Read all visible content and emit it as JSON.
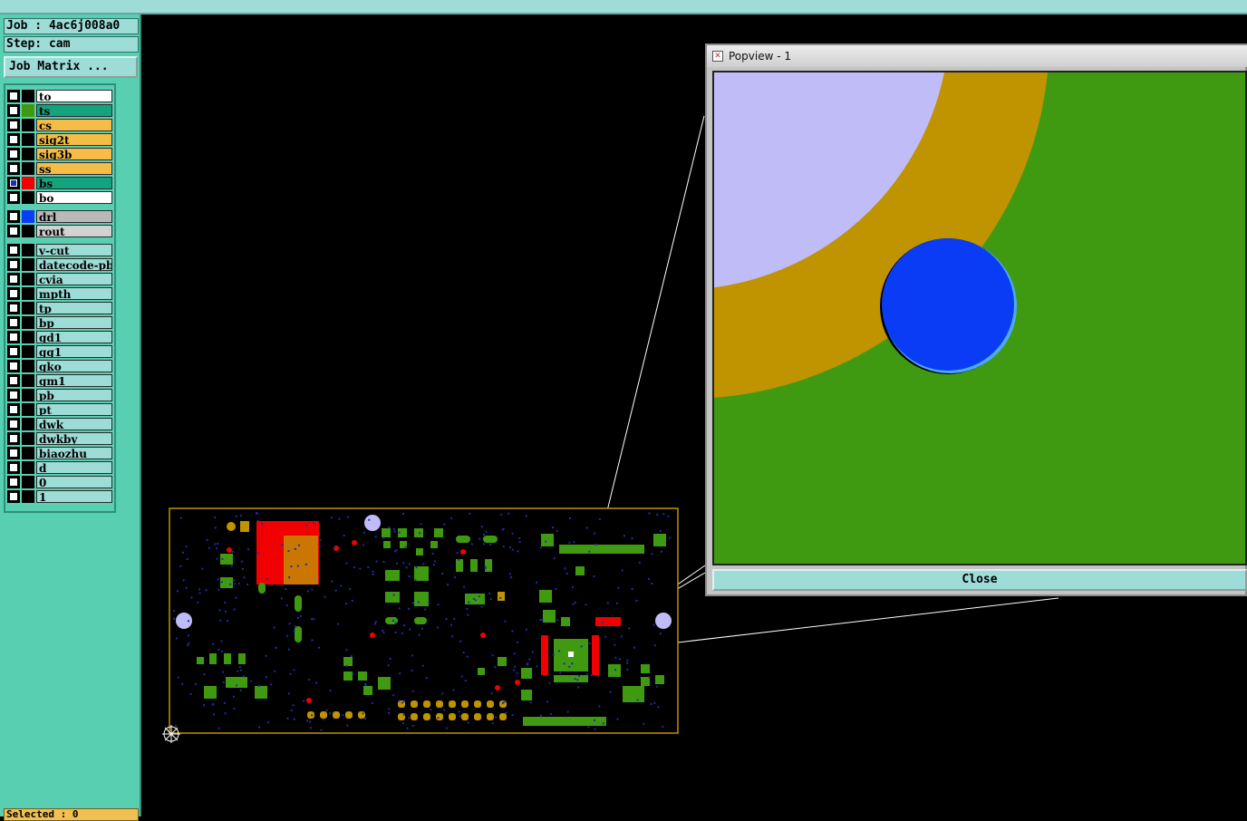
{
  "job_label": "Job : 4ac6j008a0",
  "step_label": "Step: cam",
  "job_matrix_button": "Job Matrix ...",
  "popup": {
    "title": "Popview - 1",
    "close_label": "Close"
  },
  "status": {
    "selected": "Selected : 0"
  },
  "layers": [
    {
      "name": "to",
      "bg": "#ffffff",
      "color": "#000000",
      "checked": false
    },
    {
      "name": "ts",
      "bg": "#15a37f",
      "color": "#3f9a12",
      "checked": false
    },
    {
      "name": "cs",
      "bg": "#f5bd48",
      "color": "#000000",
      "checked": false
    },
    {
      "name": "sig2t",
      "bg": "#f5bd48",
      "color": "#000000",
      "checked": false
    },
    {
      "name": "sig3b",
      "bg": "#f5bd48",
      "color": "#000000",
      "checked": false
    },
    {
      "name": "ss",
      "bg": "#f5bd48",
      "color": "#000000",
      "checked": false
    },
    {
      "name": "bs",
      "bg": "#15a37f",
      "color": "#f00000",
      "checked": true
    },
    {
      "name": "bo",
      "bg": "#ffffff",
      "color": "#000000",
      "checked": false
    },
    {
      "name": "drl",
      "bg": "#b9b9b9",
      "color": "#0a3cf5",
      "checked": false
    },
    {
      "name": "rout",
      "bg": "#d2d2d2",
      "color": "#000000",
      "checked": false
    },
    {
      "name": "v-cut",
      "bg": "#9ddcd7",
      "color": "#000000",
      "checked": false
    },
    {
      "name": "datecode-pbc",
      "bg": "#9ddcd7",
      "color": "#000000",
      "checked": false
    },
    {
      "name": "cvia",
      "bg": "#9ddcd7",
      "color": "#000000",
      "checked": false
    },
    {
      "name": "mpth",
      "bg": "#9ddcd7",
      "color": "#000000",
      "checked": false
    },
    {
      "name": "tp",
      "bg": "#9ddcd7",
      "color": "#000000",
      "checked": false
    },
    {
      "name": "bp",
      "bg": "#9ddcd7",
      "color": "#000000",
      "checked": false
    },
    {
      "name": "gd1",
      "bg": "#9ddcd7",
      "color": "#000000",
      "checked": false
    },
    {
      "name": "gg1",
      "bg": "#9ddcd7",
      "color": "#000000",
      "checked": false
    },
    {
      "name": "gko",
      "bg": "#9ddcd7",
      "color": "#000000",
      "checked": false
    },
    {
      "name": "gm1",
      "bg": "#9ddcd7",
      "color": "#000000",
      "checked": false
    },
    {
      "name": "pb",
      "bg": "#9ddcd7",
      "color": "#000000",
      "checked": false
    },
    {
      "name": "pt",
      "bg": "#9ddcd7",
      "color": "#000000",
      "checked": false
    },
    {
      "name": "dwk",
      "bg": "#9ddcd7",
      "color": "#000000",
      "checked": false
    },
    {
      "name": "dwkby",
      "bg": "#9ddcd7",
      "color": "#000000",
      "checked": false
    },
    {
      "name": "biaozhu",
      "bg": "#9ddcd7",
      "color": "#000000",
      "checked": false
    },
    {
      "name": "d",
      "bg": "#9ddcd7",
      "color": "#000000",
      "checked": false
    },
    {
      "name": "0",
      "bg": "#9ddcd7",
      "color": "#000000",
      "checked": false
    },
    {
      "name": "1",
      "bg": "#9ddcd7",
      "color": "#000000",
      "checked": false
    }
  ],
  "colors": {
    "panel": "#57cfb0",
    "light_panel": "#9ddcd7",
    "board_green": "#3f9a12",
    "copper": "#c09300",
    "drill_blue": "#0a3cf5",
    "lavender": "#c0bcf8",
    "pad_red": "#f00000"
  }
}
